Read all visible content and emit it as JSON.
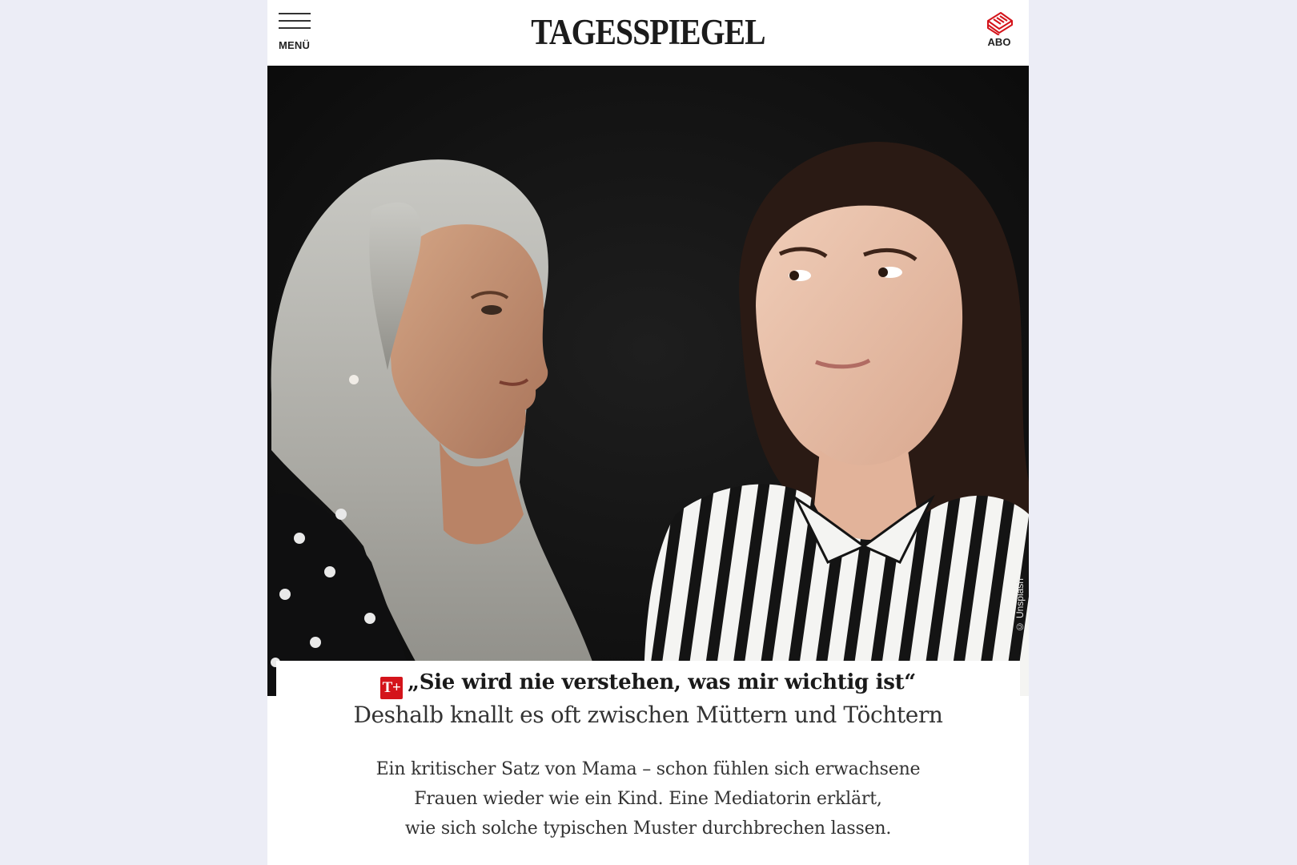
{
  "header": {
    "menu_label": "MENÜ",
    "logo_text": "TAGESSPIEGEL",
    "abo_label": "ABO"
  },
  "hero": {
    "credit": "© Unsplash"
  },
  "article": {
    "badge": "T+",
    "headline": "„Sie wird nie verstehen, was mir wichtig ist“",
    "subheadline": "Deshalb knallt es oft zwischen Müttern und Töchtern",
    "teaser_lines": [
      "Ein kritischer Satz von Mama – schon fühlen sich erwachsene",
      "Frauen wieder wie ein Kind. Eine Mediatorin erklärt,",
      "wie sich solche typischen Muster durchbrechen lassen."
    ]
  },
  "colors": {
    "page_background": "#ecedf6",
    "accent_red": "#d4141b",
    "hero_background": "#141414"
  }
}
